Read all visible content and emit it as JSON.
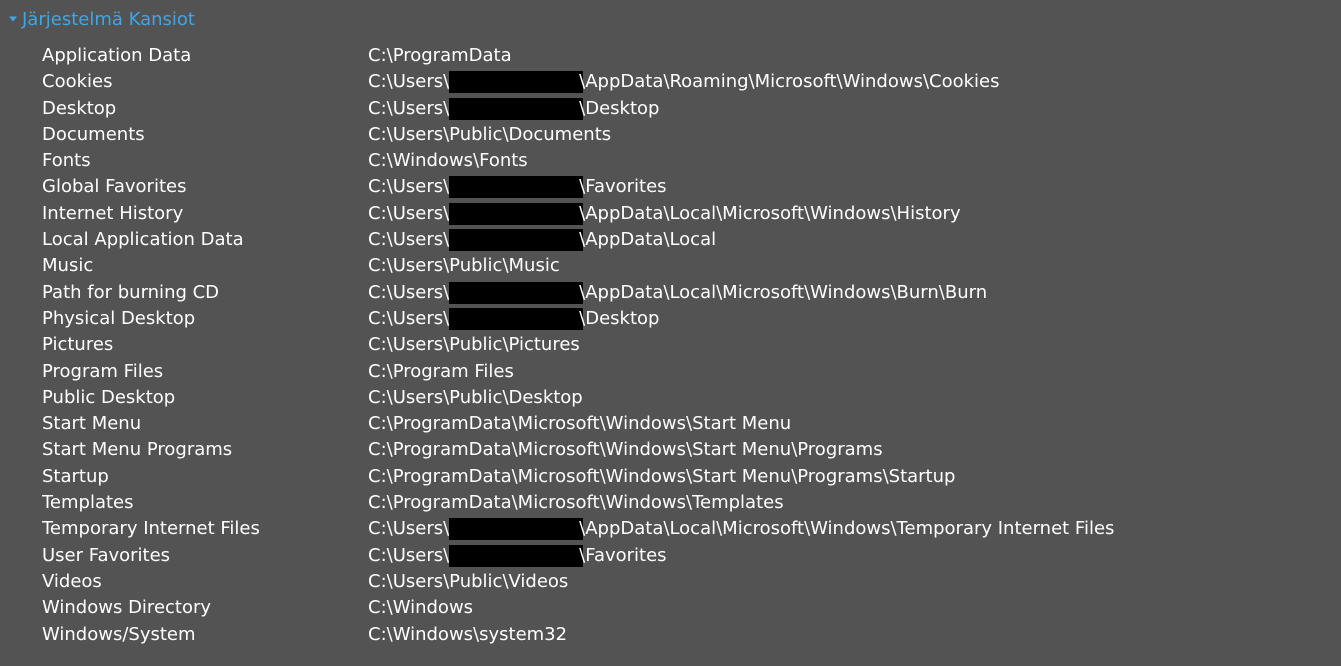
{
  "section": {
    "title": "Järjestelmä Kansiot",
    "expanded": true,
    "title_color": "#3fa6e6",
    "expander_icon": "triangle-down-icon"
  },
  "colors": {
    "background": "#535353",
    "text": "#ffffff",
    "redaction": "#000000"
  },
  "folders": [
    {
      "name": "Application Data",
      "path": "C:\\ProgramData"
    },
    {
      "name": "Cookies",
      "path_prefix": "C:\\Users\\",
      "redacted": true,
      "path_suffix": "\\AppData\\Roaming\\Microsoft\\Windows\\Cookies"
    },
    {
      "name": "Desktop",
      "path_prefix": "C:\\Users\\",
      "redacted": true,
      "path_suffix": "\\Desktop"
    },
    {
      "name": "Documents",
      "path": "C:\\Users\\Public\\Documents"
    },
    {
      "name": "Fonts",
      "path": "C:\\Windows\\Fonts"
    },
    {
      "name": "Global Favorites",
      "path_prefix": "C:\\Users\\",
      "redacted": true,
      "path_suffix": "\\Favorites"
    },
    {
      "name": "Internet History",
      "path_prefix": "C:\\Users\\",
      "redacted": true,
      "path_suffix": "\\AppData\\Local\\Microsoft\\Windows\\History"
    },
    {
      "name": "Local Application Data",
      "path_prefix": "C:\\Users\\",
      "redacted": true,
      "path_suffix": "\\AppData\\Local"
    },
    {
      "name": "Music",
      "path": "C:\\Users\\Public\\Music"
    },
    {
      "name": "Path for burning CD",
      "path_prefix": "C:\\Users\\",
      "redacted": true,
      "path_suffix": "\\AppData\\Local\\Microsoft\\Windows\\Burn\\Burn"
    },
    {
      "name": "Physical Desktop",
      "path_prefix": "C:\\Users\\",
      "redacted": true,
      "path_suffix": "\\Desktop"
    },
    {
      "name": "Pictures",
      "path": "C:\\Users\\Public\\Pictures"
    },
    {
      "name": "Program Files",
      "path": "C:\\Program Files"
    },
    {
      "name": "Public Desktop",
      "path": "C:\\Users\\Public\\Desktop"
    },
    {
      "name": "Start Menu",
      "path": "C:\\ProgramData\\Microsoft\\Windows\\Start Menu"
    },
    {
      "name": "Start Menu Programs",
      "path": "C:\\ProgramData\\Microsoft\\Windows\\Start Menu\\Programs"
    },
    {
      "name": "Startup",
      "path": "C:\\ProgramData\\Microsoft\\Windows\\Start Menu\\Programs\\Startup"
    },
    {
      "name": "Templates",
      "path": "C:\\ProgramData\\Microsoft\\Windows\\Templates"
    },
    {
      "name": "Temporary Internet Files",
      "path_prefix": "C:\\Users\\",
      "redacted": true,
      "path_suffix": "\\AppData\\Local\\Microsoft\\Windows\\Temporary Internet Files"
    },
    {
      "name": "User Favorites",
      "path_prefix": "C:\\Users\\",
      "redacted": true,
      "path_suffix": "\\Favorites"
    },
    {
      "name": "Videos",
      "path": "C:\\Users\\Public\\Videos"
    },
    {
      "name": "Windows Directory",
      "path": "C:\\Windows"
    },
    {
      "name": "Windows/System",
      "path": "C:\\Windows\\system32"
    }
  ]
}
